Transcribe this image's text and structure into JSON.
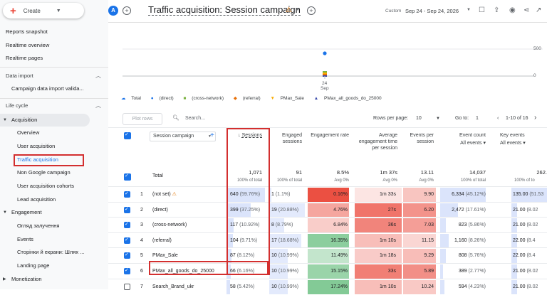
{
  "create": {
    "label": "Create"
  },
  "nav": {
    "reports_snapshot": "Reports snapshot",
    "realtime_overview": "Realtime overview",
    "realtime_pages": "Realtime pages",
    "data_import": "Data import",
    "campaign_import": "Campaign data import valida...",
    "life_cycle": "Life cycle",
    "acquisition": "Acquisition",
    "overview": "Overview",
    "user_acq": "User acquisition",
    "traffic_acq": "Traffic acquisition",
    "non_google": "Non Google campaign",
    "user_acq_cohorts": "User acquisition cohorts",
    "lead_acq": "Lead acquisition",
    "engagement": "Engagement",
    "overview_ua": "Огляд залучення",
    "events": "Events",
    "pages_screens": "Сторінки й екрани: Шлях ...",
    "landing": "Landing page",
    "monetization": "Monetization"
  },
  "header": {
    "avatar": "A",
    "title": "Traffic acquisition: Session campaign",
    "custom": "Custom",
    "date_range": "Sep 24 - Sep 24, 2026"
  },
  "chart": {
    "y_max": "500",
    "y_min": "0",
    "x_day": "24",
    "x_month": "Sep"
  },
  "legend": [
    "Total",
    "(direct)",
    "(cross-network)",
    "(referral)",
    "PMax_Sale",
    "PMax_all_goods_do_25000"
  ],
  "toolbar": {
    "plot_rows": "Plot rows",
    "search": "Search...",
    "rows_per_page_label": "Rows per page:",
    "rows_per_page": "10",
    "goto_label": "Go to:",
    "goto": "1",
    "range": "1-10 of 16"
  },
  "columns": {
    "dimension": "Session campaign",
    "sessions": "Sessions",
    "engaged": "Engaged sessions",
    "eng_rate": "Engagement rate",
    "avg_time": "Average engagement time per session",
    "events_per": "Events per session",
    "event_count": "Event count",
    "event_count_sub": "All events",
    "key_events": "Key events",
    "key_events_sub": "All events"
  },
  "totals": {
    "label": "Total",
    "sessions": "1,071",
    "sessions_sub": "100% of total",
    "engaged": "91",
    "engaged_sub": "100% of total",
    "rate": "8.5%",
    "rate_sub": "Avg 0%",
    "time": "1m 37s",
    "time_sub": "Avg 0%",
    "events_per": "13.11",
    "events_per_sub": "Avg 0%",
    "event_count": "14,037",
    "event_count_sub": "100% of total",
    "key": "262.",
    "key_sub": "100% of to"
  },
  "rows": [
    {
      "n": "1",
      "name": "(not set)",
      "warn": true,
      "sessions": "640",
      "s_pct": "(59.76%)",
      "engaged": "1",
      "e_pct": "(1.1%)",
      "rate": "0.16%",
      "time": "1m 33s",
      "events": "9.90",
      "count": "6,334",
      "c_pct": "(45.12%)",
      "key": "135.00",
      "k_pct": "(51.53"
    },
    {
      "n": "2",
      "name": "(direct)",
      "warn": false,
      "sessions": "399",
      "s_pct": "(37.25%)",
      "engaged": "19",
      "e_pct": "(20.88%)",
      "rate": "4.76%",
      "time": "27s",
      "events": "6.20",
      "count": "2,472",
      "c_pct": "(17.61%)",
      "key": "21.00",
      "k_pct": "(8.02"
    },
    {
      "n": "3",
      "name": "(cross-network)",
      "warn": false,
      "sessions": "117",
      "s_pct": "(10.92%)",
      "engaged": "8",
      "e_pct": "(8.79%)",
      "rate": "6.84%",
      "time": "36s",
      "events": "7.03",
      "count": "823",
      "c_pct": "(5.86%)",
      "key": "21.00",
      "k_pct": "(8.02"
    },
    {
      "n": "4",
      "name": "(referral)",
      "warn": false,
      "sessions": "104",
      "s_pct": "(9.71%)",
      "engaged": "17",
      "e_pct": "(18.68%)",
      "rate": "16.35%",
      "time": "1m 10s",
      "events": "11.15",
      "count": "1,160",
      "c_pct": "(8.26%)",
      "key": "22.00",
      "k_pct": "(8.4"
    },
    {
      "n": "5",
      "name": "PMax_Sale",
      "warn": false,
      "sessions": "87",
      "s_pct": "(8.12%)",
      "engaged": "10",
      "e_pct": "(10.99%)",
      "rate": "11.49%",
      "time": "1m 18s",
      "events": "9.29",
      "count": "808",
      "c_pct": "(5.76%)",
      "key": "22.00",
      "k_pct": "(8.4"
    },
    {
      "n": "6",
      "name": "PMax_all_goods_do_25000",
      "warn": false,
      "sessions": "66",
      "s_pct": "(6.16%)",
      "engaged": "10",
      "e_pct": "(10.99%)",
      "rate": "15.15%",
      "time": "33s",
      "events": "5.89",
      "count": "389",
      "c_pct": "(2.77%)",
      "key": "21.00",
      "k_pct": "(8.02"
    },
    {
      "n": "7",
      "name": "Search_Brand_ukr",
      "warn": false,
      "sessions": "58",
      "s_pct": "(5.42%)",
      "engaged": "10",
      "e_pct": "(10.99%)",
      "rate": "17.24%",
      "time": "1m 10s",
      "events": "10.24",
      "count": "594",
      "c_pct": "(4.23%)",
      "key": "21.00",
      "k_pct": "(8.02"
    }
  ]
}
